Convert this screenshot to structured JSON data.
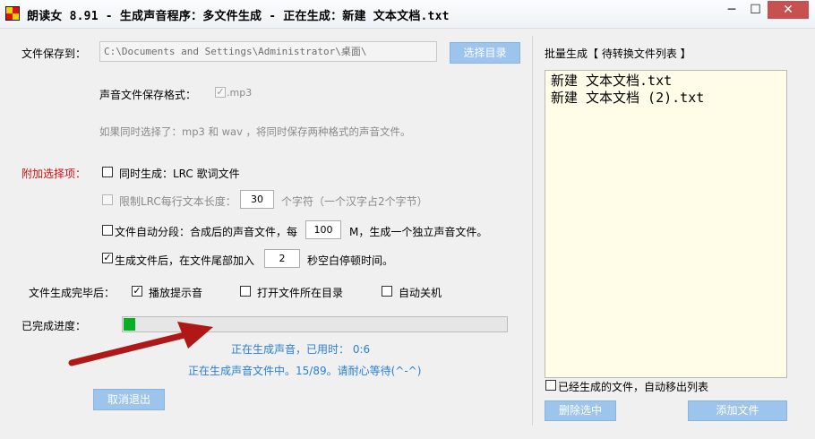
{
  "window": {
    "title": "朗读女 8.91 - 生成声音程序：多文件生成 - 正在生成：新建 文本文档.txt",
    "min_glyph": "─",
    "max_glyph": "☐",
    "close_glyph": "✕"
  },
  "save": {
    "label": "文件保存到：",
    "path": "C:\\Documents and Settings\\Administrator\\桌面\\",
    "choose_button": "选择目录"
  },
  "format": {
    "label": "声音文件保存格式：",
    "mp3_label": ".mp3",
    "hint": "如果同时选择了：mp3 和 wav ，将同时保存两种格式的声音文件。"
  },
  "options": {
    "title": "附加选择项：",
    "lrc_label": "同时生成：LRC 歌词文件",
    "lrc_limit_label": "限制LRC每行文本长度：",
    "lrc_limit_value": "30",
    "lrc_limit_suffix": "个字符（一个汉字占2个字节）",
    "split_label": "文件自动分段：合成后的声音文件，每",
    "split_value": "100",
    "split_suffix": "M，生成一个独立声音文件。",
    "pause_label": "生成文件后，在文件尾部加入",
    "pause_value": "2",
    "pause_suffix": "秒空白停顿时间。"
  },
  "after": {
    "label": "文件生成完毕后：",
    "play_sound": "播放提示音",
    "open_folder": "打开文件所在目录",
    "shutdown": "自动关机"
  },
  "progress": {
    "label": "已完成进度：",
    "fraction": 0.03,
    "status1": "正在生成声音，已用时： 0:6",
    "status2": "正在生成声音文件中。15/89。请耐心等待(^-^)",
    "cancel_button": "取消退出"
  },
  "batch": {
    "title": "批量生成【 待转换文件列表 】",
    "files": [
      "新建 文本文档.txt",
      "新建 文本文档 (2).txt"
    ],
    "remove_done_label": "已经生成的文件，自动移出列表",
    "delete_selected_button": "删除选中",
    "add_file_button": "添加文件"
  },
  "colors": {
    "progress_fill": "#06b025",
    "accent_button": "#9dc4ec",
    "red_label": "#d01010",
    "status_blue": "#2a7fd6",
    "close_button": "#c75050"
  }
}
